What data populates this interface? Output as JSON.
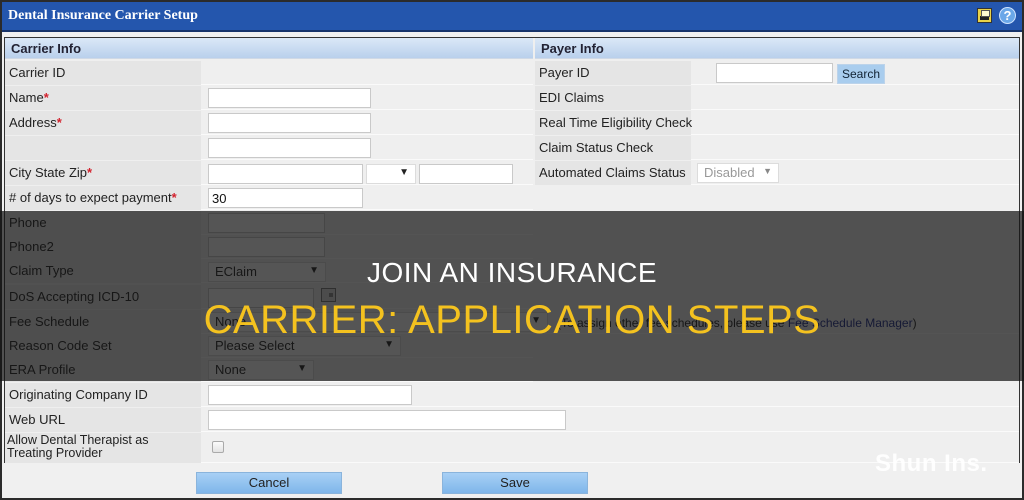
{
  "window": {
    "title": "Dental Insurance Carrier Setup",
    "icons": [
      "print-icon",
      "help-icon"
    ],
    "help_glyph": "?"
  },
  "carrier_info": {
    "heading": "Carrier Info",
    "required_marker": "*",
    "fields": {
      "carrier_id": {
        "label": "Carrier ID",
        "value": ""
      },
      "name": {
        "label": "Name",
        "required": true,
        "value": ""
      },
      "address": {
        "label": "Address",
        "required": true,
        "value_line1": "",
        "value_line2": ""
      },
      "city_state_zip": {
        "label": "City State Zip",
        "required": true,
        "city": "",
        "state": "",
        "zip": ""
      },
      "days_to_expect_payment": {
        "label": "# of days to expect payment",
        "required": true,
        "value": "30"
      },
      "phone": {
        "label": "Phone",
        "value": ""
      },
      "phone2": {
        "label": "Phone2",
        "value": ""
      },
      "claim_type": {
        "label": "Claim Type",
        "selected": "EClaim"
      },
      "dos_accepting_icd10": {
        "label": "DoS Accepting ICD-10",
        "value": ""
      },
      "fee_schedule": {
        "label": "Fee Schedule",
        "selected": "None",
        "hint_prefix": "(To assign other fee schedules, please use ",
        "hint_link": "Fee Schedule Manager",
        "hint_suffix": ")"
      },
      "reason_code_set": {
        "label": "Reason Code Set",
        "selected": "Please Select"
      },
      "era_profile": {
        "label": "ERA Profile",
        "selected": "None"
      },
      "originating_company_id": {
        "label": "Originating Company ID",
        "value": ""
      },
      "web_url": {
        "label": "Web URL",
        "value": ""
      },
      "allow_dental_therapist": {
        "label_line1": "Allow Dental Therapist as",
        "label_line2": "Treating Provider",
        "checked": false
      }
    }
  },
  "payer_info": {
    "heading": "Payer Info",
    "fields": {
      "payer_id": {
        "label": "Payer ID",
        "value": "",
        "search_label": "Search"
      },
      "edi_claims": {
        "label": "EDI Claims"
      },
      "real_time_eligibility": {
        "label": "Real Time Eligibility Check"
      },
      "claim_status_check": {
        "label": "Claim Status Check"
      },
      "automated_claims_status": {
        "label": "Automated Claims Status",
        "selected": "Disabled",
        "disabled": true
      }
    }
  },
  "footer": {
    "cancel_label": "Cancel",
    "save_label": "Save"
  },
  "overlay": {
    "line1": "JOIN AN INSURANCE",
    "line2": "CARRIER: APPLICATION STEPS",
    "watermark": "Shun Ins.",
    "line2_color": "#f4c21f"
  },
  "colors": {
    "titlebar": "#2456ad",
    "section_header": "#c7daf0",
    "required": "#d3212d",
    "button": "#a8d0f5"
  }
}
